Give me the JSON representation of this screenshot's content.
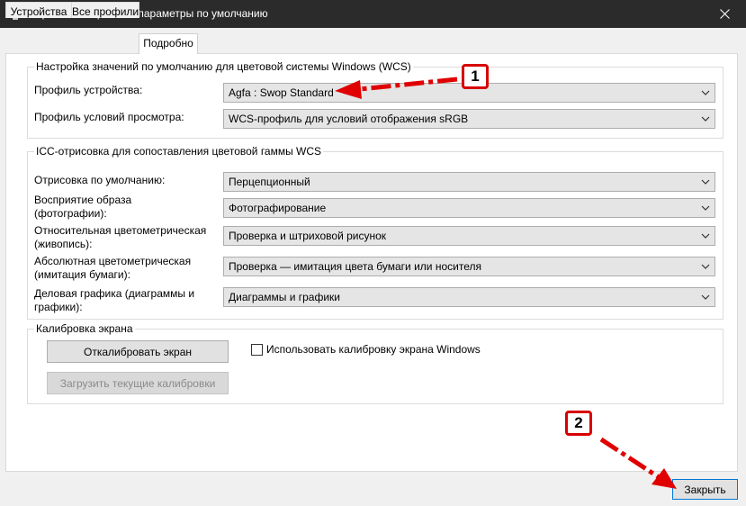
{
  "window": {
    "title": "Управление цветом - параметры по умолчанию",
    "icon": "color-management-icon",
    "close_icon": "close-icon"
  },
  "tabs": [
    {
      "label": "Устройства",
      "active": false
    },
    {
      "label": "Все профили",
      "active": false
    },
    {
      "label": "Подробно",
      "active": true
    }
  ],
  "wcs_group": {
    "title": "Настройка значений по умолчанию для цветовой системы Windows (WCS)",
    "device_profile_label": "Профиль устройства:",
    "device_profile_value": "Agfa : Swop Standard",
    "viewing_profile_label": "Профиль условий просмотра:",
    "viewing_profile_value": "WCS-профиль для условий отображения sRGB"
  },
  "icc_group": {
    "title": "ICC-отрисовка для сопоставления цветовой гаммы WCS",
    "rows": [
      {
        "label": "Отрисовка по умолчанию:",
        "value": "Перцепционный"
      },
      {
        "label": "Восприятие образа\n(фотографии):",
        "value": "Фотографирование"
      },
      {
        "label": "Относительная цветометрическая\n(живопись):",
        "value": "Проверка и штриховой рисунок"
      },
      {
        "label": "Абсолютная цветометрическая\n(имитация бумаги):",
        "value": "Проверка — имитация цвета бумаги или носителя"
      },
      {
        "label": "Деловая графика (диаграммы и\nграфики):",
        "value": "Диаграммы и графики"
      }
    ]
  },
  "calibration_group": {
    "title": "Калибровка экрана",
    "calibrate_button": "Откалибровать экран",
    "load_button": "Загрузить текущие калибровки",
    "use_windows_calibration_label": "Использовать калибровку экрана Windows",
    "use_windows_calibration_checked": false
  },
  "close_button": "Закрыть",
  "annotations": {
    "badge1": "1",
    "badge2": "2",
    "color": "#e00000"
  }
}
